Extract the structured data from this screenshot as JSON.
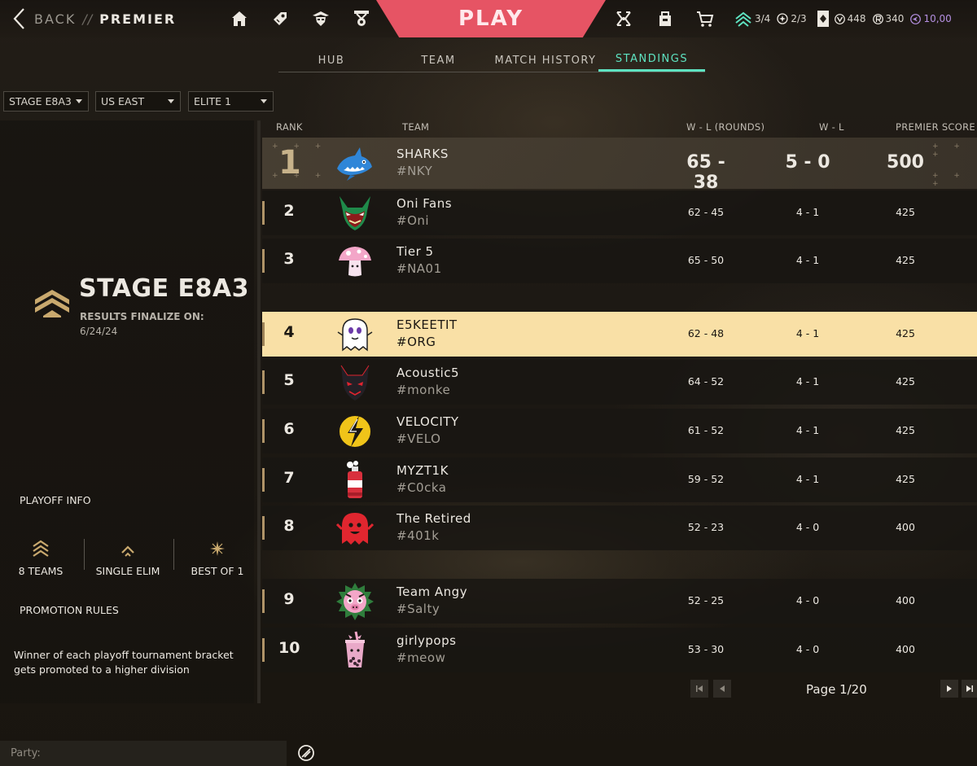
{
  "header": {
    "back_label": "BACK",
    "separator": "//",
    "breadcrumb": "PREMIER",
    "play_label": "PLAY",
    "nav_icons": [
      "home-icon",
      "collection-icon",
      "agents-icon",
      "career-icon"
    ],
    "right_icons": [
      "premier-icon",
      "battlepass-icon",
      "store-cart-icon"
    ],
    "stats": {
      "premier_matches": "3/4",
      "radiant_progress": "2/3",
      "valorant_points": "448",
      "radianite_points": "340",
      "kingdom_credits": "10,00"
    }
  },
  "tabs": [
    {
      "label": "HUB",
      "active": false
    },
    {
      "label": "TEAM",
      "active": false
    },
    {
      "label": "MATCH HISTORY",
      "active": false
    },
    {
      "label": "STANDINGS",
      "active": true
    }
  ],
  "filters": {
    "stage": "STAGE E8A3",
    "region": "US EAST",
    "division": "ELITE 1"
  },
  "left_panel": {
    "stage_title": "STAGE E8A3",
    "results_label": "RESULTS FINALIZE ON:",
    "results_date": "6/24/24",
    "playoff_title": "PLAYOFF INFO",
    "playoff_items": [
      {
        "label": "8 TEAMS",
        "icon": "teams-chevron-icon"
      },
      {
        "label": "SINGLE ELIM",
        "icon": "single-elim-chevron-icon"
      },
      {
        "label": "BEST OF 1",
        "icon": "best-of-star-icon"
      }
    ],
    "promotion_title": "PROMOTION RULES",
    "promotion_text": "Winner of each playoff tournament bracket gets promoted to a higher division"
  },
  "table": {
    "headers": {
      "rank": "RANK",
      "team": "TEAM",
      "wl_rounds": "W - L (ROUNDS)",
      "wl": "W - L",
      "score": "PREMIER SCORE"
    },
    "rows": [
      {
        "rank": "1",
        "name": "SHARKS",
        "tag": "#NKY",
        "wl_rounds": "65 - 38",
        "wl": "5 - 0",
        "score": "500",
        "logo": "shark-logo-icon"
      },
      {
        "rank": "2",
        "name": "Oni Fans",
        "tag": "#Oni",
        "wl_rounds": "62 - 45",
        "wl": "4 - 1",
        "score": "425",
        "logo": "oni-mask-logo-icon"
      },
      {
        "rank": "3",
        "name": "Tier 5",
        "tag": "#NA01",
        "wl_rounds": "65 - 50",
        "wl": "4 - 1",
        "score": "425",
        "logo": "mushroom-logo-icon"
      },
      {
        "rank": "4",
        "name": "E5KEETIT",
        "tag": "#ORG",
        "wl_rounds": "62 - 48",
        "wl": "4 - 1",
        "score": "425",
        "logo": "ghost-logo-icon",
        "highlighted": true
      },
      {
        "rank": "5",
        "name": "Acoustic5",
        "tag": "#monke",
        "wl_rounds": "64 - 52",
        "wl": "4 - 1",
        "score": "425",
        "logo": "demon-logo-icon"
      },
      {
        "rank": "6",
        "name": "VELOCITY",
        "tag": "#VELO",
        "wl_rounds": "61 - 52",
        "wl": "4 - 1",
        "score": "425",
        "logo": "lightning-logo-icon"
      },
      {
        "rank": "7",
        "name": "MYZT1K",
        "tag": "#C0cka",
        "wl_rounds": "59 - 52",
        "wl": "4 - 1",
        "score": "425",
        "logo": "spray-can-logo-icon"
      },
      {
        "rank": "8",
        "name": "The Retired",
        "tag": "#401k",
        "wl_rounds": "52 - 23",
        "wl": "4 - 0",
        "score": "400",
        "logo": "red-ghost-logo-icon"
      },
      {
        "rank": "9",
        "name": "Team Angy",
        "tag": "#Salty",
        "wl_rounds": "52 - 25",
        "wl": "4 - 0",
        "score": "400",
        "logo": "angry-pig-logo-icon"
      },
      {
        "rank": "10",
        "name": "girlypops",
        "tag": "#meow",
        "wl_rounds": "53 - 30",
        "wl": "4 - 0",
        "score": "400",
        "logo": "boba-cup-logo-icon"
      }
    ]
  },
  "pagination": {
    "page_text": "Page 1/20"
  },
  "footer": {
    "party_label": "Party:"
  },
  "colors": {
    "accent_teal": "#5ee3c1",
    "play_red": "#e65464",
    "highlight_row": "#f9e0a6",
    "gold": "#b09468"
  }
}
